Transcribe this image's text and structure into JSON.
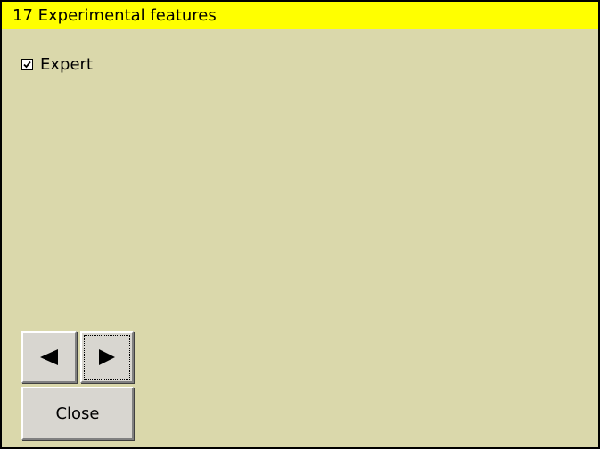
{
  "dialog": {
    "title": "17 Experimental features"
  },
  "options": [
    {
      "label": "Expert",
      "checked": true
    }
  ],
  "navigation": {
    "prev_icon": "left-triangle-icon",
    "next_icon": "right-triangle-icon",
    "close_label": "Close"
  },
  "colors": {
    "title_background": "#ffff00",
    "window_background": "#dad8ab",
    "button_face": "#d8d6d0"
  }
}
